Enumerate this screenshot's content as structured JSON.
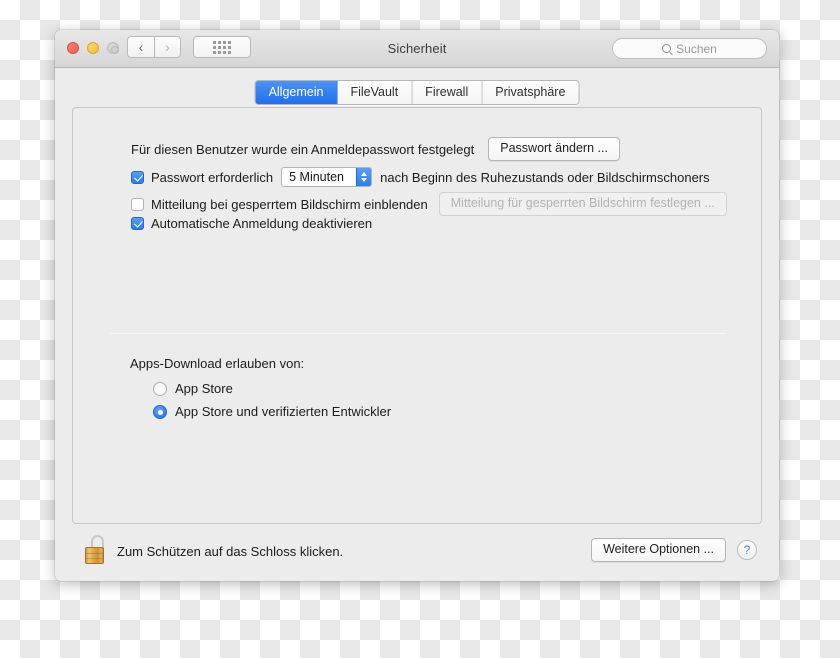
{
  "window": {
    "title": "Sicherheit",
    "traffic_lights": [
      "close",
      "minimize",
      "zoom-disabled"
    ],
    "nav": {
      "back": "‹",
      "forward": "›"
    },
    "grid_button": "show-all-icon",
    "search": {
      "placeholder": "Suchen",
      "icon": "search-icon"
    }
  },
  "tabs": [
    {
      "label": "Allgemein",
      "active": true
    },
    {
      "label": "FileVault",
      "active": false
    },
    {
      "label": "Firewall",
      "active": false
    },
    {
      "label": "Privatsphäre",
      "active": false
    }
  ],
  "general": {
    "password_set_label": "Für diesen Benutzer wurde ein Anmeldepasswort festgelegt",
    "change_password_button": "Passwort ändern ...",
    "require_password": {
      "checked": true,
      "label": "Passwort erforderlich",
      "delay_value": "5 Minuten",
      "suffix": "nach Beginn des Ruhezustands oder Bildschirmschoners"
    },
    "lock_message": {
      "checked": false,
      "label": "Mitteilung bei gesperrtem Bildschirm einblenden",
      "button": "Mitteilung für gesperrten Bildschirm festlegen ...",
      "button_disabled": true
    },
    "disable_auto_login": {
      "checked": true,
      "label": "Automatische Anmeldung deaktivieren"
    },
    "downloads": {
      "title": "Apps-Download erlauben von:",
      "options": [
        {
          "label": "App Store",
          "selected": false
        },
        {
          "label": "App Store und verifizierten Entwickler",
          "selected": true
        }
      ]
    }
  },
  "footer": {
    "lock_icon": "padlock-open-icon",
    "lock_text": "Zum Schützen auf das Schloss klicken.",
    "advanced_button": "Weitere Optionen ...",
    "help_button": "?"
  },
  "colors": {
    "accent": "#2f7de8",
    "window_bg": "#ececec",
    "title_text": "#3b3b3b"
  }
}
